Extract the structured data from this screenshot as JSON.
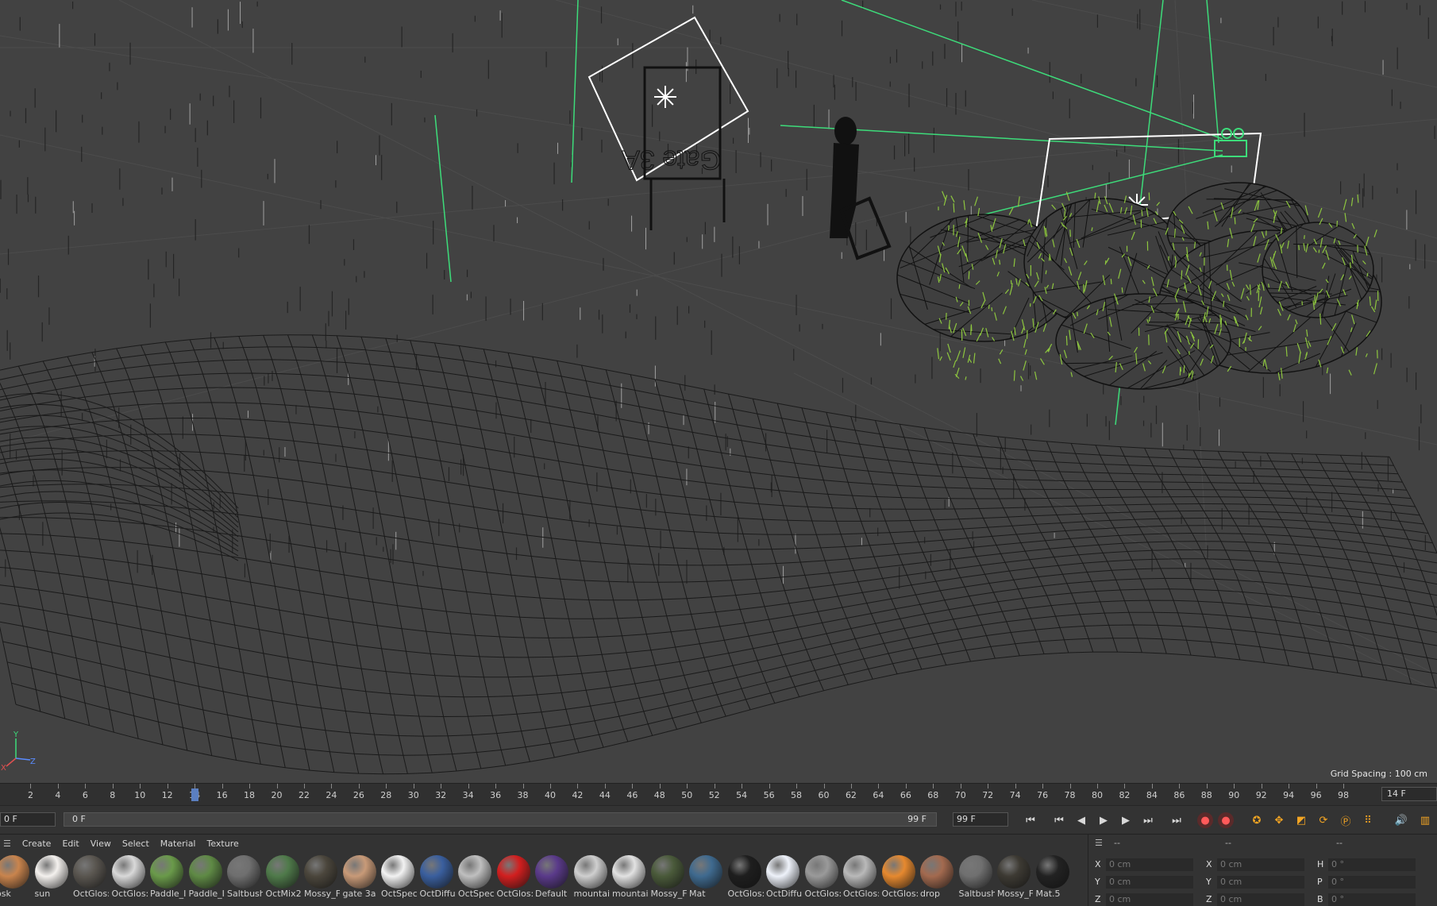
{
  "viewport": {
    "grid_spacing": "Grid Spacing : 100 cm",
    "sign_text": "Gate 3A",
    "axis": {
      "x": "X",
      "y": "Y",
      "z": "Z"
    }
  },
  "timeline": {
    "ticks": [
      "2",
      "4",
      "6",
      "8",
      "10",
      "12",
      "14",
      "16",
      "18",
      "20",
      "22",
      "24",
      "26",
      "28",
      "30",
      "32",
      "34",
      "36",
      "38",
      "40",
      "42",
      "44",
      "46",
      "48",
      "50",
      "52",
      "54",
      "56",
      "58",
      "60",
      "62",
      "64",
      "66",
      "68",
      "70",
      "72",
      "74",
      "76",
      "78",
      "80",
      "82",
      "84",
      "86",
      "88",
      "90",
      "92",
      "94",
      "96",
      "98"
    ],
    "playhead": 14,
    "current_frame": "14 F"
  },
  "transport": {
    "start_field": "0 F",
    "range_start": "0 F",
    "range_end": "99 F",
    "end_field": "99 F"
  },
  "materials": {
    "menu": [
      "Create",
      "Edit",
      "View",
      "Select",
      "Material",
      "Texture"
    ],
    "items": [
      {
        "name": "osk",
        "color": "#c9844d"
      },
      {
        "name": "sun",
        "color": "#f4f1ee"
      },
      {
        "name": "OctGlos:",
        "color": "#5a5650"
      },
      {
        "name": "OctGlos:",
        "color": "#d9d9d9"
      },
      {
        "name": "Paddle_I",
        "color": "#6a9a4a"
      },
      {
        "name": "Paddle_I",
        "color": "#5f8a45"
      },
      {
        "name": "Saltbush",
        "color": "#6f6f6f"
      },
      {
        "name": "OctMix2",
        "color": "#4f7a4a"
      },
      {
        "name": "Mossy_F",
        "color": "#4b463c"
      },
      {
        "name": "gate 3a",
        "color": "#c89a78"
      },
      {
        "name": "OctSpec",
        "color": "#f2f2f2"
      },
      {
        "name": "OctDiffu",
        "color": "#3a5f9e"
      },
      {
        "name": "OctSpec",
        "color": "#bfbfbf"
      },
      {
        "name": "OctGlos:",
        "color": "#d21f1f"
      },
      {
        "name": "Default",
        "color": "#5a3a8a"
      },
      {
        "name": "mountai",
        "color": "#cfcfcf"
      },
      {
        "name": "mountai",
        "color": "#e2e2e2"
      },
      {
        "name": "Mossy_F",
        "color": "#4a5a3a"
      },
      {
        "name": "Mat",
        "color": "#3f6a8f"
      },
      {
        "name": "OctGlos:",
        "color": "#1e1e1e"
      },
      {
        "name": "OctDiffu",
        "color": "#eef2fa"
      },
      {
        "name": "OctGlos:",
        "color": "#9a9a9a"
      },
      {
        "name": "OctGlos:",
        "color": "#b9b9b9"
      },
      {
        "name": "OctGlos:",
        "color": "#e6892f"
      },
      {
        "name": "drop",
        "color": "#a36a4f"
      },
      {
        "name": "Saltbush",
        "color": "#707070"
      },
      {
        "name": "Mossy_F",
        "color": "#3d3a33"
      },
      {
        "name": "Mat.5",
        "color": "#222222"
      }
    ]
  },
  "attributes": {
    "header": [
      "--",
      "--",
      "--"
    ],
    "rows": [
      {
        "k": "X",
        "v": "0 cm"
      },
      {
        "k": "X",
        "v": "0 cm"
      },
      {
        "k": "H",
        "v": "0 °"
      },
      {
        "k": "Y",
        "v": "0 cm"
      },
      {
        "k": "Y",
        "v": "0 cm"
      },
      {
        "k": "P",
        "v": "0 °"
      },
      {
        "k": "Z",
        "v": "0 cm"
      },
      {
        "k": "Z",
        "v": "0 cm"
      },
      {
        "k": "B",
        "v": "0 °"
      }
    ]
  }
}
